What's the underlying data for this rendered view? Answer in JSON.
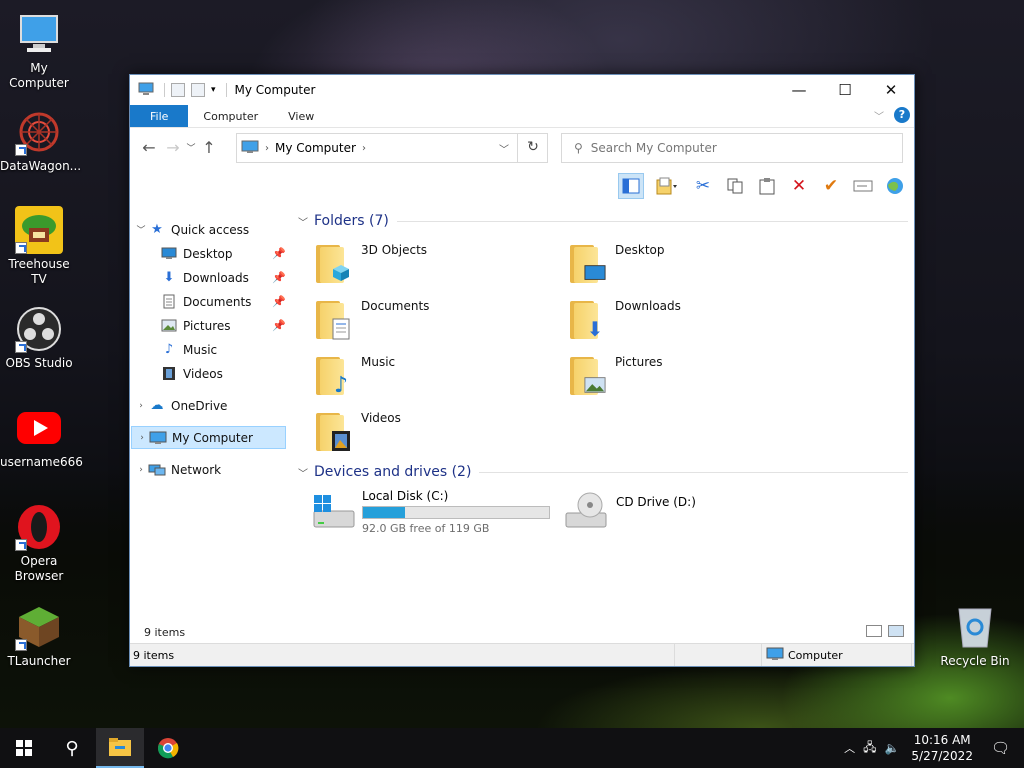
{
  "desktop": {
    "icons": [
      {
        "label": "My Computer",
        "icon": "computer-icon"
      },
      {
        "label": "DataWagon...",
        "icon": "datawagon-icon"
      },
      {
        "label": "Treehouse TV",
        "icon": "treehouse-icon"
      },
      {
        "label": "OBS Studio",
        "icon": "obs-icon"
      },
      {
        "label": "username666",
        "icon": "youtube-icon"
      },
      {
        "label": "Opera Browser",
        "icon": "opera-icon"
      },
      {
        "label": "TLauncher",
        "icon": "minecraft-icon"
      },
      {
        "label": "Recycle Bin",
        "icon": "recycle-bin-icon"
      }
    ]
  },
  "window": {
    "title": "My Computer",
    "controls": {
      "minimize": "—",
      "maximize": "☐",
      "close": "✕"
    },
    "ribbon_tabs": [
      "File",
      "Computer",
      "View"
    ],
    "help": "?",
    "address": {
      "crumb": "My Computer"
    },
    "search": {
      "placeholder": "Search My Computer"
    },
    "toolbar_icons": [
      "preview-pane-icon",
      "properties-icon",
      "cut-icon",
      "copy-icon",
      "paste-icon",
      "delete-icon",
      "checkmark-icon",
      "rename-icon",
      "globe-icon"
    ],
    "nav": {
      "quick_access": "Quick access",
      "items": [
        {
          "label": "Desktop",
          "icon": "desktop-icon",
          "pinned": true
        },
        {
          "label": "Downloads",
          "icon": "downloads-icon",
          "pinned": true
        },
        {
          "label": "Documents",
          "icon": "documents-icon",
          "pinned": true
        },
        {
          "label": "Pictures",
          "icon": "pictures-icon",
          "pinned": true
        },
        {
          "label": "Music",
          "icon": "music-icon",
          "pinned": false
        },
        {
          "label": "Videos",
          "icon": "videos-icon",
          "pinned": false
        }
      ],
      "onedrive": "OneDrive",
      "my_computer": "My Computer",
      "network": "Network"
    },
    "folders_header": "Folders (7)",
    "folders": [
      {
        "label": "3D Objects",
        "icon": "3d-objects-icon"
      },
      {
        "label": "Desktop",
        "icon": "desktop-icon"
      },
      {
        "label": "Documents",
        "icon": "documents-icon"
      },
      {
        "label": "Downloads",
        "icon": "downloads-icon"
      },
      {
        "label": "Music",
        "icon": "music-icon"
      },
      {
        "label": "Pictures",
        "icon": "pictures-icon"
      },
      {
        "label": "Videos",
        "icon": "videos-icon"
      }
    ],
    "drives_header": "Devices and drives (2)",
    "drives": [
      {
        "label": "Local Disk (C:)",
        "free": "92.0 GB free of 119 GB",
        "used_fraction": 0.227
      },
      {
        "label": "CD Drive (D:)"
      }
    ],
    "status_items": "9 items",
    "statusbar_items": "9 items",
    "statusbar_location": "Computer"
  },
  "taskbar": {
    "time": "10:16 AM",
    "date": "5/27/2022",
    "accent": "#76b9ed"
  }
}
